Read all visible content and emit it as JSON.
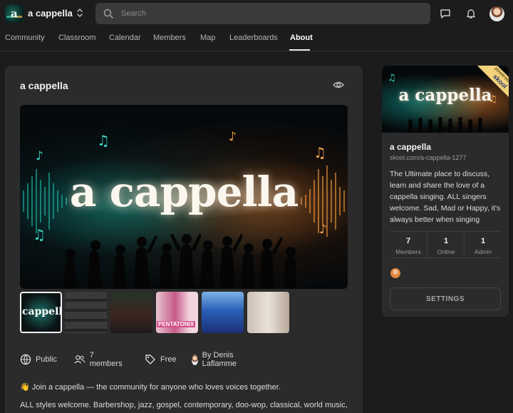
{
  "header": {
    "community_name": "a cappella",
    "logo_letter": "a",
    "search_placeholder": "Search",
    "icons": [
      "switcher-icon",
      "search-icon",
      "chat-icon",
      "bell-icon",
      "avatar"
    ]
  },
  "nav": {
    "tabs": [
      {
        "label": "Community",
        "active": false
      },
      {
        "label": "Classroom",
        "active": false
      },
      {
        "label": "Calendar",
        "active": false
      },
      {
        "label": "Members",
        "active": false
      },
      {
        "label": "Map",
        "active": false
      },
      {
        "label": "Leaderboards",
        "active": false
      },
      {
        "label": "About",
        "active": true
      }
    ]
  },
  "main": {
    "title": "a cappella",
    "hero_text": "a cappella",
    "thumbnails": [
      {
        "label": "cappell",
        "selected": true
      },
      {
        "label": "",
        "selected": false
      },
      {
        "label": "",
        "selected": false
      },
      {
        "label": "PENTATONIX",
        "selected": false
      },
      {
        "label": "",
        "selected": false
      },
      {
        "label": "",
        "selected": false
      }
    ],
    "meta": {
      "privacy": "Public",
      "members": "7 members",
      "price": "Free",
      "owner": "By Denis Laflamme"
    },
    "description_line1": "👋 Join a cappella — the community for anyone who loves voices together.",
    "description_line2": "ALL styles welcome. Barbershop, jazz, gospel, contemporary, doo-wop, classical, world music,"
  },
  "sidebar": {
    "banner_text": "a cappella",
    "ribbon_top": "powered by",
    "ribbon_brand": "skool",
    "name": "a cappella",
    "url": "skool.com/a-cappella-1277",
    "description": "The Ultimate place to discuss, learn and share the love of a cappella singing. ALL singers welcome. Sad, Mad or Happy, it's always better when singing",
    "stats": [
      {
        "value": "7",
        "label": "Members"
      },
      {
        "value": "1",
        "label": "Online"
      },
      {
        "value": "1",
        "label": "Admin"
      }
    ],
    "settings_label": "SETTINGS"
  },
  "colors": {
    "background": "#1c1c1c",
    "card": "#2b2b2b",
    "search": "#3a3a3a",
    "teal_glow": "#1fc6b2",
    "orange_glow": "#f09a3e",
    "ribbon": "#f2d37a"
  }
}
